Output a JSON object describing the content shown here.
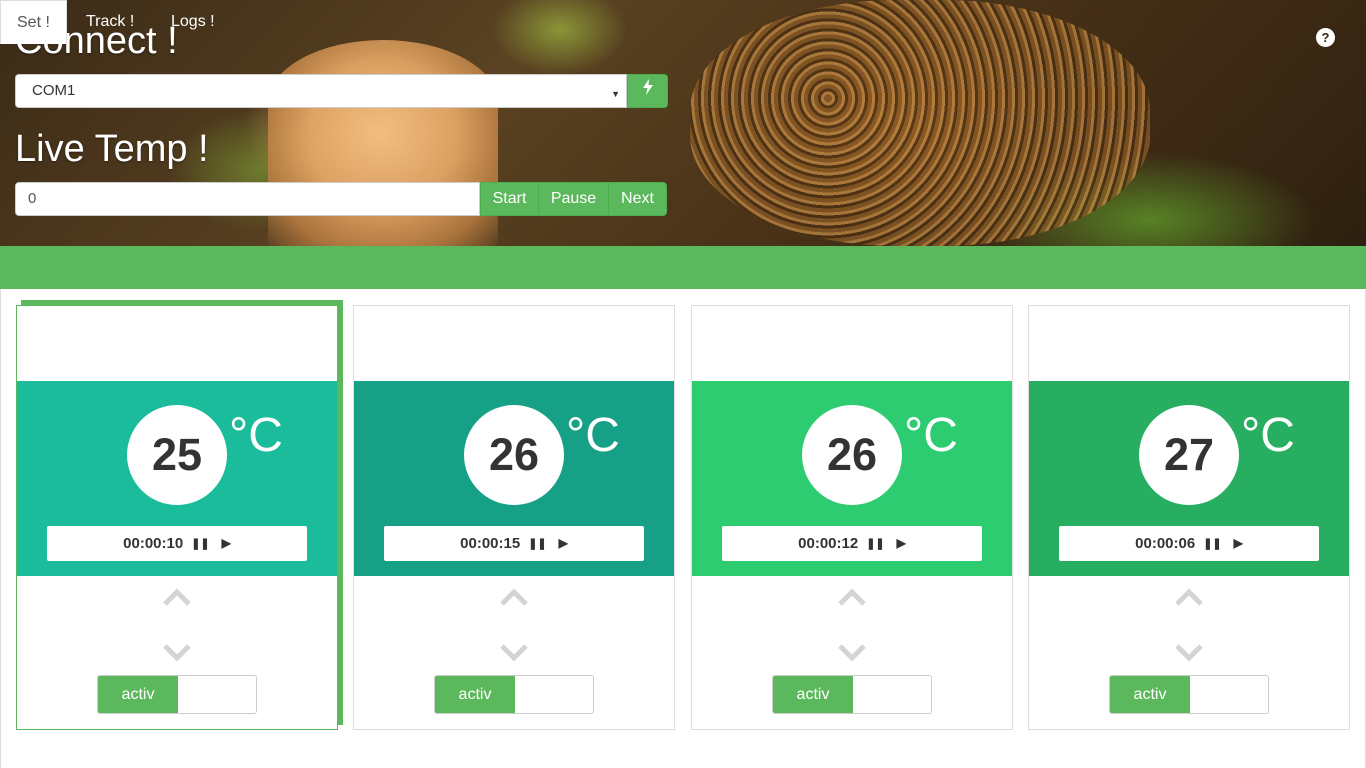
{
  "header": {
    "connect_title": "Connect !",
    "port_value": "COM1",
    "connect_icon": "bolt-icon",
    "help_icon": "question-circle-icon",
    "live_temp_title": "Live Temp !",
    "live_temp_value": "0",
    "buttons": {
      "start": "Start",
      "pause": "Pause",
      "next": "Next"
    }
  },
  "tabs": [
    {
      "label": "Set !",
      "active": true
    },
    {
      "label": "Track !",
      "active": false
    },
    {
      "label": "Logs !",
      "active": false
    }
  ],
  "unit": "°C",
  "cards": [
    {
      "temp": "25",
      "time": "00:00:10",
      "color": "#1abc9c",
      "toggle": "activ",
      "selected": true
    },
    {
      "temp": "26",
      "time": "00:00:15",
      "color": "#16a085",
      "toggle": "activ",
      "selected": false
    },
    {
      "temp": "26",
      "time": "00:00:12",
      "color": "#2ecc71",
      "toggle": "activ",
      "selected": false
    },
    {
      "temp": "27",
      "time": "00:00:06",
      "color": "#27ae60",
      "toggle": "activ",
      "selected": false
    }
  ],
  "icons": {
    "pause": "pause-icon",
    "play": "play-icon",
    "up": "chevron-up-icon",
    "down": "chevron-down-icon"
  }
}
